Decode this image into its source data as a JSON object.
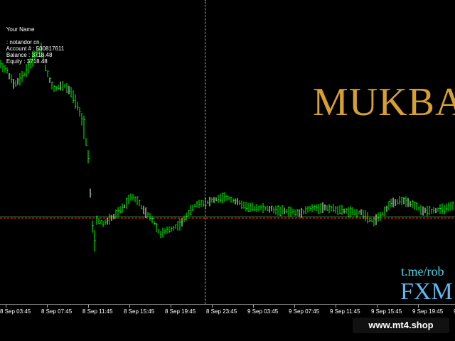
{
  "info": {
    "account_label": "Your Name",
    "name_value": ": notandor cn",
    "account_number": "Account # : 500817611",
    "balance": "Balance : 3718.48",
    "equity": "Equity : 3718.48"
  },
  "overlay": {
    "brand": "MUKBA",
    "telegram": "t.me/rob",
    "fxm": "FXM"
  },
  "x_axis_labels": [
    "8 Sep 03:45",
    "8 Sep 07:45",
    "8 Sep 11:45",
    "8 Sep 15:45",
    "8 Sep 19:45",
    "8 Sep 23:45",
    "9 Sep 03:45",
    "9 Sep 07:45",
    "9 Sep 11:45",
    "9 Sep 15:45",
    "9 Sep 19:45",
    "9 Se"
  ],
  "footer": {
    "site": "www.mt4.shop"
  },
  "colors": {
    "bull": "#00ff00",
    "bear": "#ffffff",
    "price_line": "#ff3300",
    "grid": "#cccccc"
  }
}
